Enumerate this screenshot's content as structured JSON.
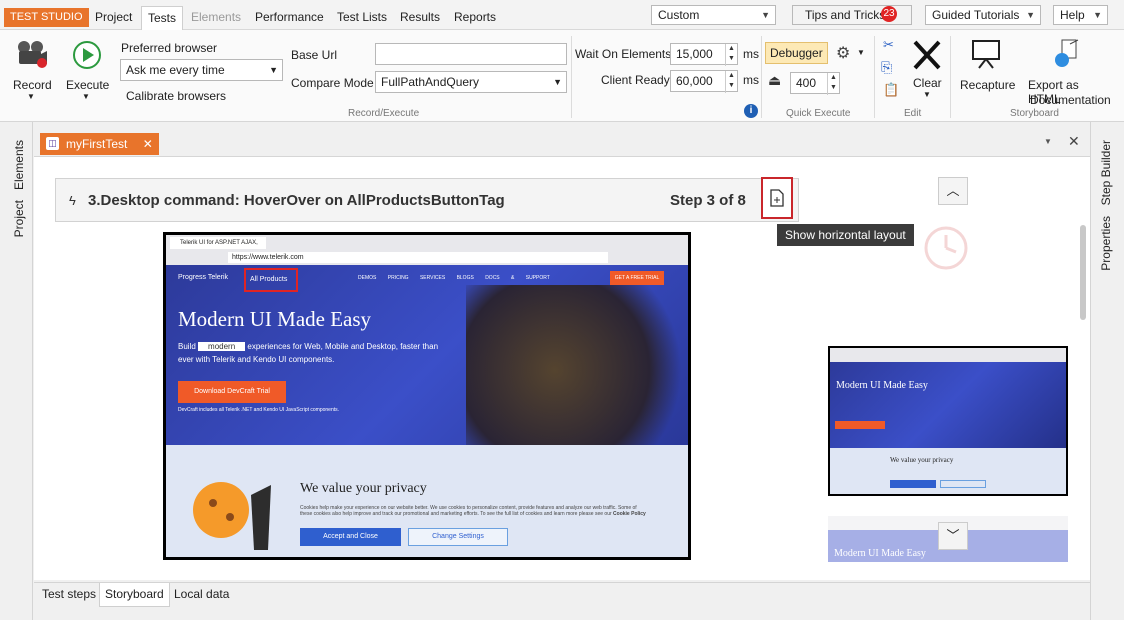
{
  "menu": {
    "brand": "TEST STUDIO",
    "tabs": [
      "Project",
      "Tests",
      "Elements",
      "Performance",
      "Test Lists",
      "Results",
      "Reports"
    ],
    "layout_select": "Custom",
    "tips": "Tips and Tricks",
    "tips_count": "23",
    "guided": "Guided Tutorials",
    "help": "Help"
  },
  "ribbon": {
    "record": "Record",
    "execute": "Execute",
    "preferred_browser": "Preferred browser",
    "browser_value": "Ask me every time",
    "calibrate": "Calibrate browsers",
    "base_url": "Base Url",
    "base_url_value": "",
    "compare_mode": "Compare Mode",
    "compare_value": "FullPathAndQuery",
    "group_record": "Record/Execute",
    "wait_elements": "Wait On Elements",
    "wait_value": "15,000",
    "client_ready": "Client Ready",
    "client_value": "60,000",
    "ms": "ms",
    "debugger": "Debugger",
    "quick_value": "400",
    "group_quick": "Quick Execute",
    "clear": "Clear",
    "group_edit": "Edit",
    "recapture": "Recapture",
    "export": "Export as HTML",
    "export2": "Documentation",
    "group_story": "Storyboard"
  },
  "rails": {
    "left": [
      "Elements",
      "Project"
    ],
    "right": [
      "Step Builder",
      "Properties"
    ]
  },
  "doc": {
    "tab": "myFirstTest",
    "step_title": "3.Desktop command: HoverOver on AllProductsButtonTag",
    "step_count": "Step 3 of 8",
    "tooltip": "Show horizontal layout"
  },
  "preview": {
    "tab_title": "Telerik UI for ASP.NET AJAX, M...",
    "url": "https://www.telerik.com",
    "logo": "Progress Telerik",
    "all_products": "All Products",
    "nav": [
      "DEMOS",
      "PRICING",
      "SERVICES",
      "BLOGS",
      "DOCS & SUPPORT"
    ],
    "trial_btn": "GET A FREE TRIAL",
    "headline": "Modern UI Made Easy",
    "sub_1": "Build",
    "sub_word": "modern",
    "sub_2": "experiences for Web, Mobile and Desktop, faster than",
    "sub_3": "ever with Telerik and Kendo UI components.",
    "download": "Download DevCraft Trial",
    "devcraft_note": "DevCraft includes all Telerik .NET and Kendo UI JavaScript components.",
    "privacy_title": "We value your privacy",
    "privacy_text": "Cookies help make your experience on our website better. We use cookies to personalize content, provide features and analyze our web traffic. Some of these cookies also help improve and track our promotional and marketing efforts. To see the full list of cookies and learn more please see our",
    "cookie_policy": "Cookie Policy",
    "accept": "Accept and Close",
    "change": "Change Settings"
  },
  "bottom_tabs": [
    "Test steps",
    "Storyboard",
    "Local data"
  ]
}
